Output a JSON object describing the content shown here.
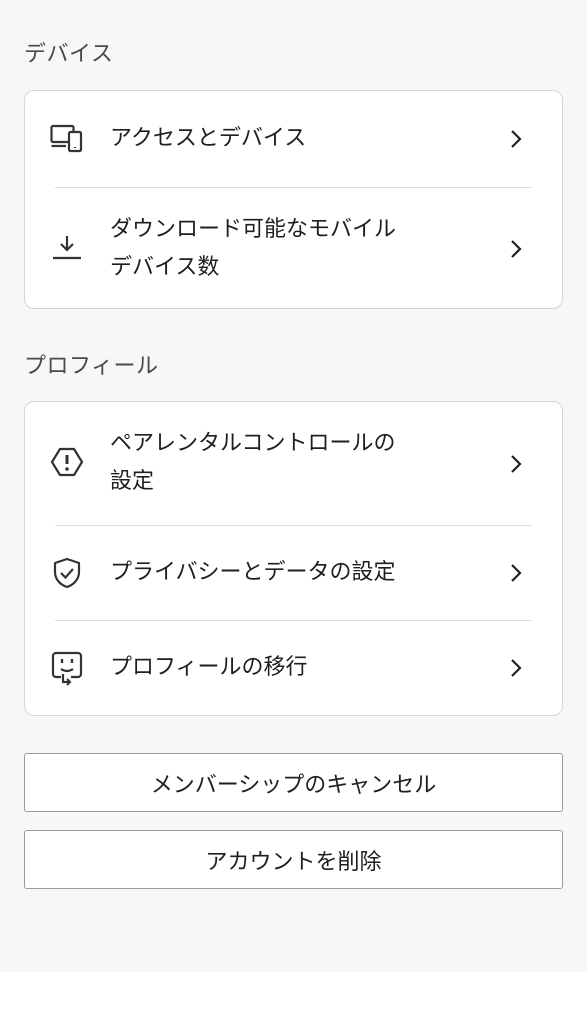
{
  "devices": {
    "section_title": "デバイス",
    "items": [
      {
        "label": "アクセスとデバイス",
        "icon": "devices-icon"
      },
      {
        "label": "ダウンロード可能なモバイル\nデバイス数",
        "icon": "download-icon"
      }
    ]
  },
  "profile": {
    "section_title": "プロフィール",
    "items": [
      {
        "label": "ペアレンタルコントロールの\n設定",
        "icon": "parental-control-icon"
      },
      {
        "label": "プライバシーとデータの設定",
        "icon": "shield-check-icon"
      },
      {
        "label": "プロフィールの移行",
        "icon": "profile-transfer-icon"
      }
    ]
  },
  "actions": {
    "cancel_membership": "メンバーシップのキャンセル",
    "delete_account": "アカウントを削除"
  },
  "colors": {
    "background": "#f7f7f7",
    "card": "#ffffff",
    "border": "#d6d6d6",
    "text": "#1f1f1f"
  }
}
